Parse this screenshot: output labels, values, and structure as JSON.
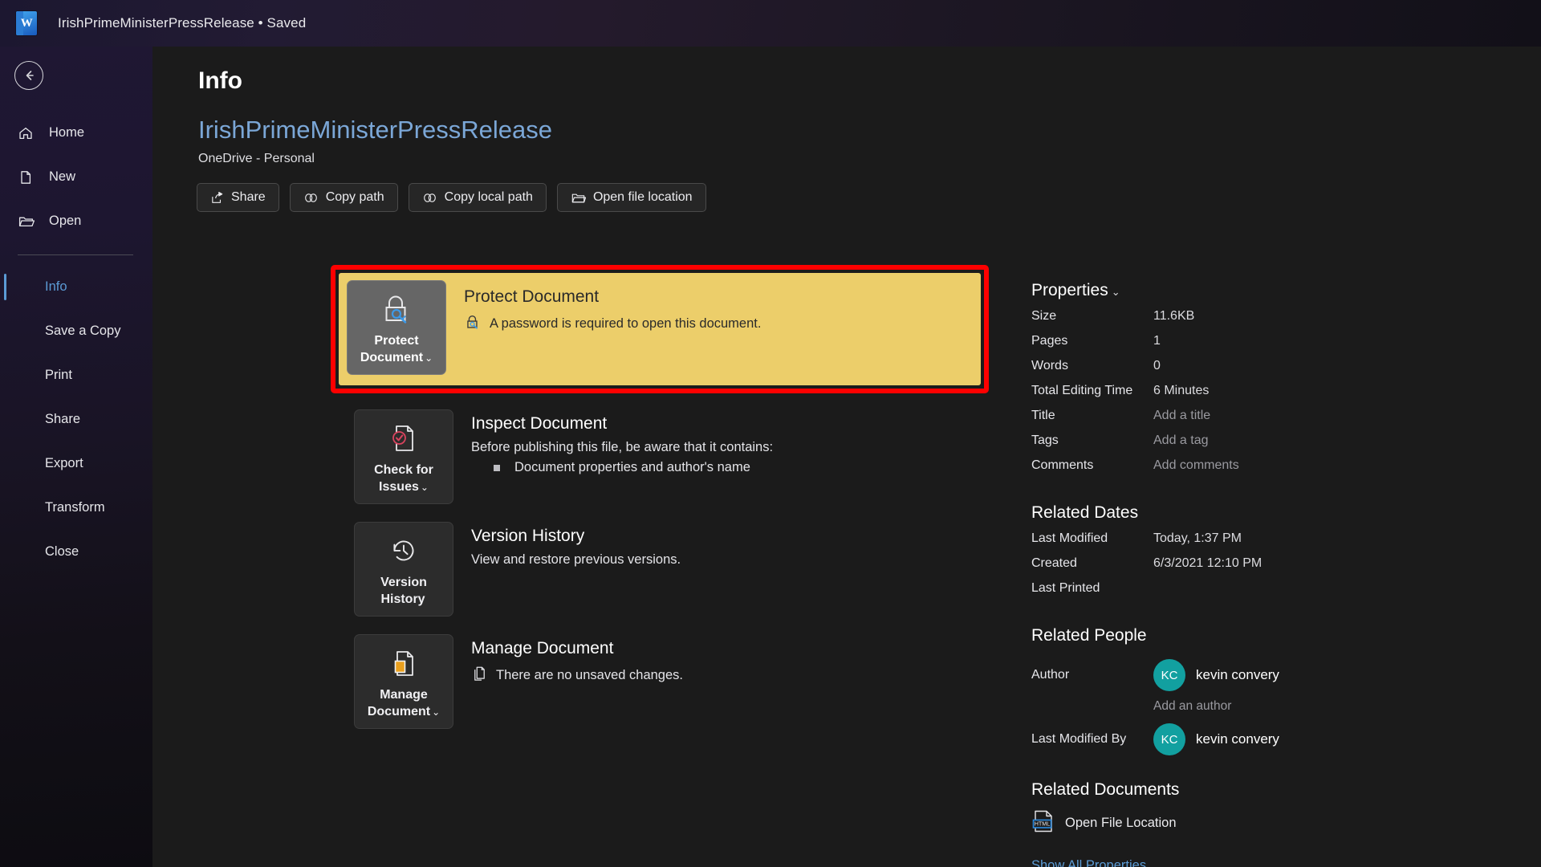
{
  "titlebar": {
    "app_icon": "word-icon",
    "filename": "IrishPrimeMinisterPressRelease",
    "separator": "•",
    "save_state": "Saved",
    "full_title": "IrishPrimeMinisterPressRelease • Saved"
  },
  "sidebar": {
    "back_icon": "back-arrow-icon",
    "items": [
      {
        "label": "Home",
        "icon": "home-icon",
        "type": "top",
        "active": false
      },
      {
        "label": "New",
        "icon": "page-icon",
        "type": "top",
        "active": false
      },
      {
        "label": "Open",
        "icon": "folder-icon",
        "type": "top",
        "active": false
      },
      {
        "label": "Info",
        "icon": "",
        "type": "sub",
        "active": true
      },
      {
        "label": "Save a Copy",
        "icon": "",
        "type": "sub",
        "active": false
      },
      {
        "label": "Print",
        "icon": "",
        "type": "sub",
        "active": false
      },
      {
        "label": "Share",
        "icon": "",
        "type": "sub",
        "active": false
      },
      {
        "label": "Export",
        "icon": "",
        "type": "sub",
        "active": false
      },
      {
        "label": "Transform",
        "icon": "",
        "type": "sub",
        "active": false
      },
      {
        "label": "Close",
        "icon": "",
        "type": "sub",
        "active": false
      }
    ]
  },
  "main": {
    "page_title": "Info",
    "document_name": "IrishPrimeMinisterPressRelease",
    "document_location": "OneDrive - Personal",
    "action_buttons": [
      {
        "label": "Share",
        "icon": "share-icon"
      },
      {
        "label": "Copy path",
        "icon": "link-icon"
      },
      {
        "label": "Copy local path",
        "icon": "link-icon"
      },
      {
        "label": "Open file location",
        "icon": "open-folder-icon"
      }
    ],
    "sections": [
      {
        "id": "protect",
        "button_label_line1": "Protect",
        "button_label_line2": "Document",
        "button_chevron": "⌄",
        "button_icon": "lock-key-icon",
        "title": "Protect Document",
        "status_icon": "lock-key-small-icon",
        "status_text": "A password is required to open this document.",
        "highlighted": true,
        "highlight_color": "#fe0000",
        "card_color": "#ecce6a"
      },
      {
        "id": "inspect",
        "button_label_line1": "Check for",
        "button_label_line2": "Issues",
        "button_chevron": "⌄",
        "button_icon": "document-check-icon",
        "title": "Inspect Document",
        "status_text": "Before publishing this file, be aware that it contains:",
        "bullets": [
          "Document properties and author's name"
        ]
      },
      {
        "id": "version-history",
        "button_label_line1": "Version",
        "button_label_line2": "History",
        "button_chevron": "",
        "button_icon": "history-clock-icon",
        "title": "Version History",
        "status_text": "View and restore previous versions."
      },
      {
        "id": "manage-document",
        "button_label_line1": "Manage",
        "button_label_line2": "Document",
        "button_chevron": "⌄",
        "button_icon": "manage-document-icon",
        "title": "Manage Document",
        "status_icon": "unsaved-changes-icon",
        "status_text": "There are no unsaved changes."
      }
    ]
  },
  "properties": {
    "heading": "Properties",
    "chevron": "⌄",
    "rows": [
      {
        "key": "Size",
        "value": "11.6KB",
        "muted": false
      },
      {
        "key": "Pages",
        "value": "1",
        "muted": false
      },
      {
        "key": "Words",
        "value": "0",
        "muted": false
      },
      {
        "key": "Total Editing Time",
        "value": "6 Minutes",
        "muted": false
      },
      {
        "key": "Title",
        "value": "Add a title",
        "muted": true
      },
      {
        "key": "Tags",
        "value": "Add a tag",
        "muted": true
      },
      {
        "key": "Comments",
        "value": "Add comments",
        "muted": true
      }
    ]
  },
  "related_dates": {
    "heading": "Related Dates",
    "rows": [
      {
        "key": "Last Modified",
        "value": "Today, 1:37 PM"
      },
      {
        "key": "Created",
        "value": "6/3/2021 12:10 PM"
      },
      {
        "key": "Last Printed",
        "value": ""
      }
    ]
  },
  "related_people": {
    "heading": "Related People",
    "author_key": "Author",
    "author_initials": "KC",
    "author_name": "kevin convery",
    "add_author_label": "Add an author",
    "modified_by_key": "Last Modified By",
    "modified_by_initials": "KC",
    "modified_by_name": "kevin convery",
    "avatar_color": "#12a0a0"
  },
  "related_documents": {
    "heading": "Related Documents",
    "link_label": "Open File Location",
    "link_icon": "html-file-icon",
    "icon_text": "HTML",
    "show_all_label": "Show All Properties"
  }
}
